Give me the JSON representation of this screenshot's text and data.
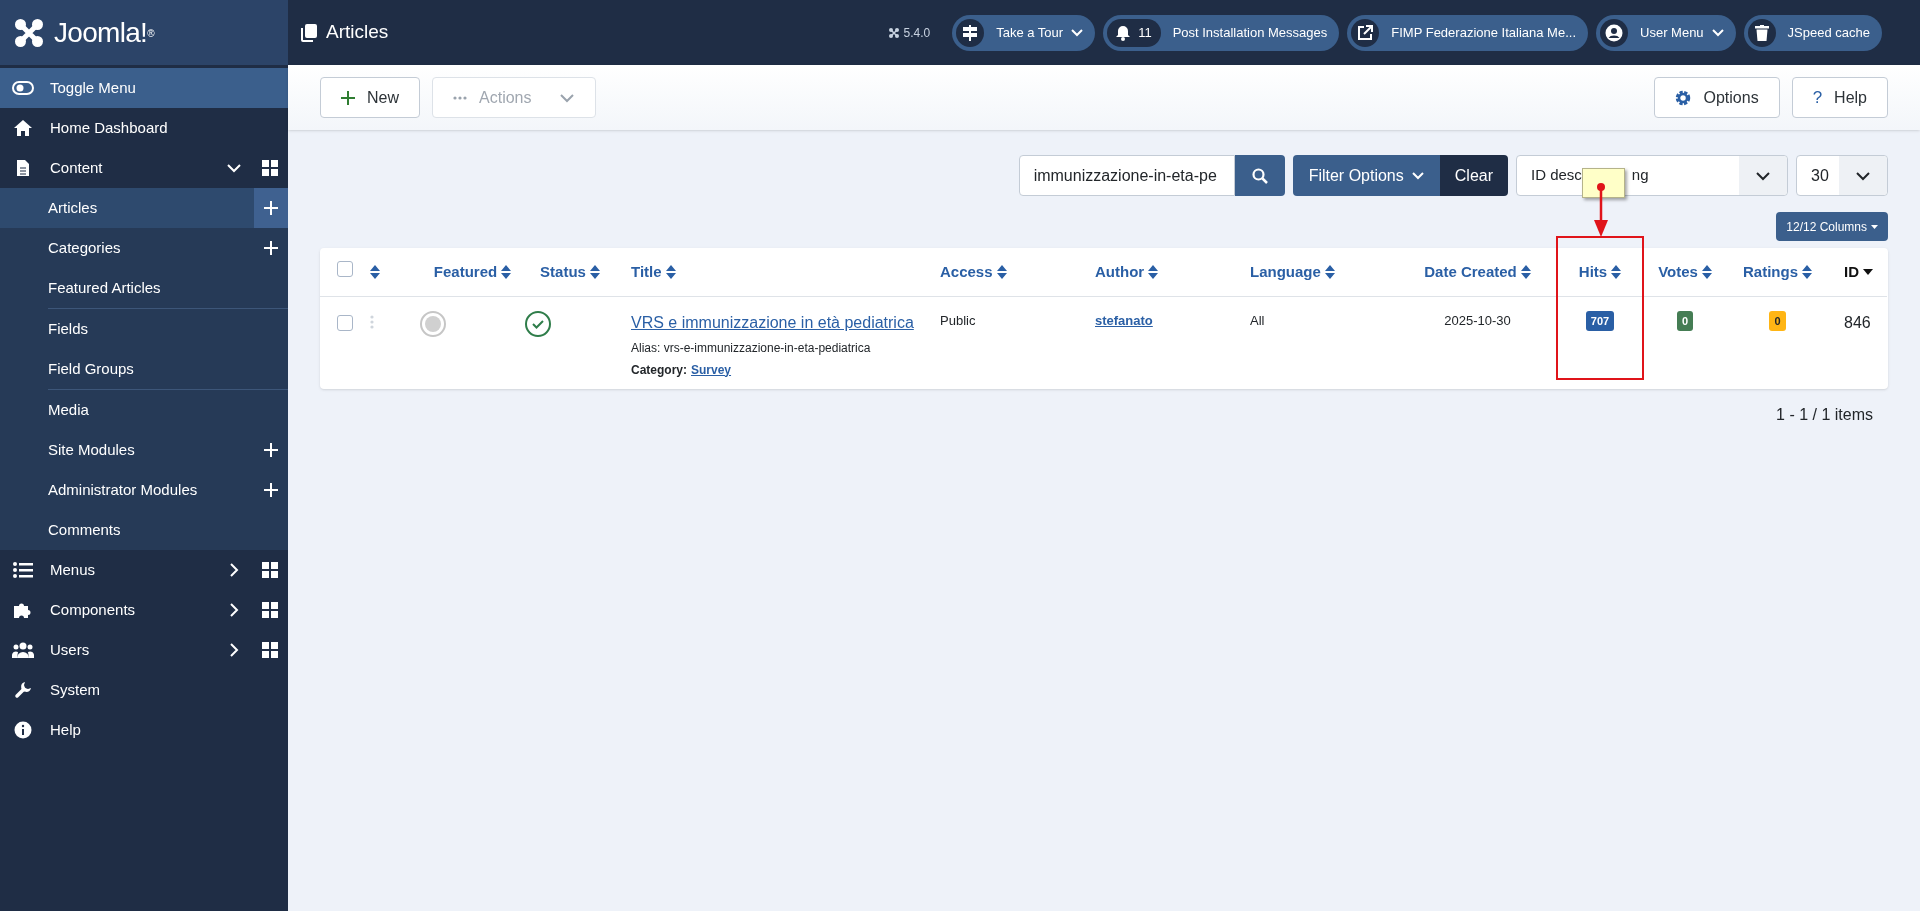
{
  "brand": {
    "name": "Joomla!$^{®}$"
  },
  "header": {
    "title": "Articles",
    "version": "5.4.0",
    "pills": [
      {
        "kind": "tour",
        "label": "Take a Tour",
        "caret": true
      },
      {
        "kind": "messages",
        "count": "11",
        "label": "Post Installation Messages",
        "caret": false
      },
      {
        "kind": "site",
        "label": "FIMP Federazione Italiana Me...",
        "caret": false
      },
      {
        "kind": "user",
        "label": "User Menu",
        "caret": true
      },
      {
        "kind": "cache",
        "label": "JSpeed cache",
        "caret": false
      }
    ]
  },
  "sidebar": {
    "items": [
      {
        "kind": "toggle",
        "label": "Toggle Menu"
      },
      {
        "kind": "link",
        "label": "Home Dashboard"
      },
      {
        "kind": "group",
        "label": "Content",
        "expanded": true,
        "children": [
          {
            "label": "Articles",
            "selected": true,
            "add": true,
            "divider_after": false
          },
          {
            "label": "Categories",
            "selected": false,
            "add": true,
            "divider_after": false
          },
          {
            "label": "Featured Articles",
            "selected": false,
            "add": false,
            "divider_after": true
          },
          {
            "label": "Fields",
            "selected": false,
            "add": false,
            "divider_after": false
          },
          {
            "label": "Field Groups",
            "selected": false,
            "add": false,
            "divider_after": true
          },
          {
            "label": "Media",
            "selected": false,
            "add": false,
            "divider_after": false
          },
          {
            "label": "Site Modules",
            "selected": false,
            "add": true,
            "divider_after": false
          },
          {
            "label": "Administrator Modules",
            "selected": false,
            "add": true,
            "divider_after": false
          },
          {
            "label": "Comments",
            "selected": false,
            "add": false,
            "divider_after": false
          }
        ]
      },
      {
        "kind": "group",
        "label": "Menus",
        "expanded": false
      },
      {
        "kind": "group",
        "label": "Components",
        "expanded": false
      },
      {
        "kind": "group",
        "label": "Users",
        "expanded": false
      },
      {
        "kind": "link",
        "label": "System"
      },
      {
        "kind": "link",
        "label": "Help"
      }
    ]
  },
  "toolbar": {
    "left": [
      {
        "kind": "new",
        "label": "New",
        "disabled": false
      },
      {
        "kind": "actions",
        "label": "Actions",
        "disabled": true
      }
    ],
    "right": [
      {
        "kind": "options",
        "label": "Options"
      },
      {
        "kind": "help",
        "glyph": "?",
        "label": "Help"
      }
    ]
  },
  "filters": {
    "search_value": "immunizzazione-in-eta-pe",
    "filter_options": "Filter Options",
    "clear": "Clear",
    "ordering_parts": [
      "ID desc",
      "ng"
    ],
    "limit": "30",
    "columns_button": "12/12 Columns"
  },
  "table": {
    "columns": [
      {
        "kind": "checkbox",
        "checked": false
      },
      {
        "kind": "order",
        "sorted": false
      },
      {
        "kind": "text",
        "label": "Featured",
        "sorted": false
      },
      {
        "kind": "text",
        "label": "Status",
        "sorted": false
      },
      {
        "kind": "text",
        "label": "Title",
        "sorted": false
      },
      {
        "kind": "text",
        "label": "Access",
        "sorted": false
      },
      {
        "kind": "text",
        "label": "Author",
        "sorted": false
      },
      {
        "kind": "text",
        "label": "Language",
        "sorted": false
      },
      {
        "kind": "text",
        "label": "Date Created",
        "sorted": false
      },
      {
        "kind": "text",
        "label": "Hits",
        "sorted": false
      },
      {
        "kind": "text",
        "label": "Votes",
        "sorted": false
      },
      {
        "kind": "text",
        "label": "Ratings",
        "sorted": false
      },
      {
        "kind": "text",
        "label": "ID",
        "sorted": true
      }
    ],
    "rows": [
      {
        "checked": false,
        "featured": false,
        "published": true,
        "title": "VRS e immunizzazione in età pediatrica",
        "alias": "Alias: vrs-e-immunizzazione-in-eta-pediatrica",
        "category_label": "Category:",
        "category": "Survey",
        "access": "Public",
        "author": "stefanato",
        "language": "All",
        "date_created": "2025-10-30",
        "hits": "707",
        "votes": "0",
        "ratings": "0",
        "id": "846"
      }
    ]
  },
  "pagination": "1 - 1 / 1 items"
}
